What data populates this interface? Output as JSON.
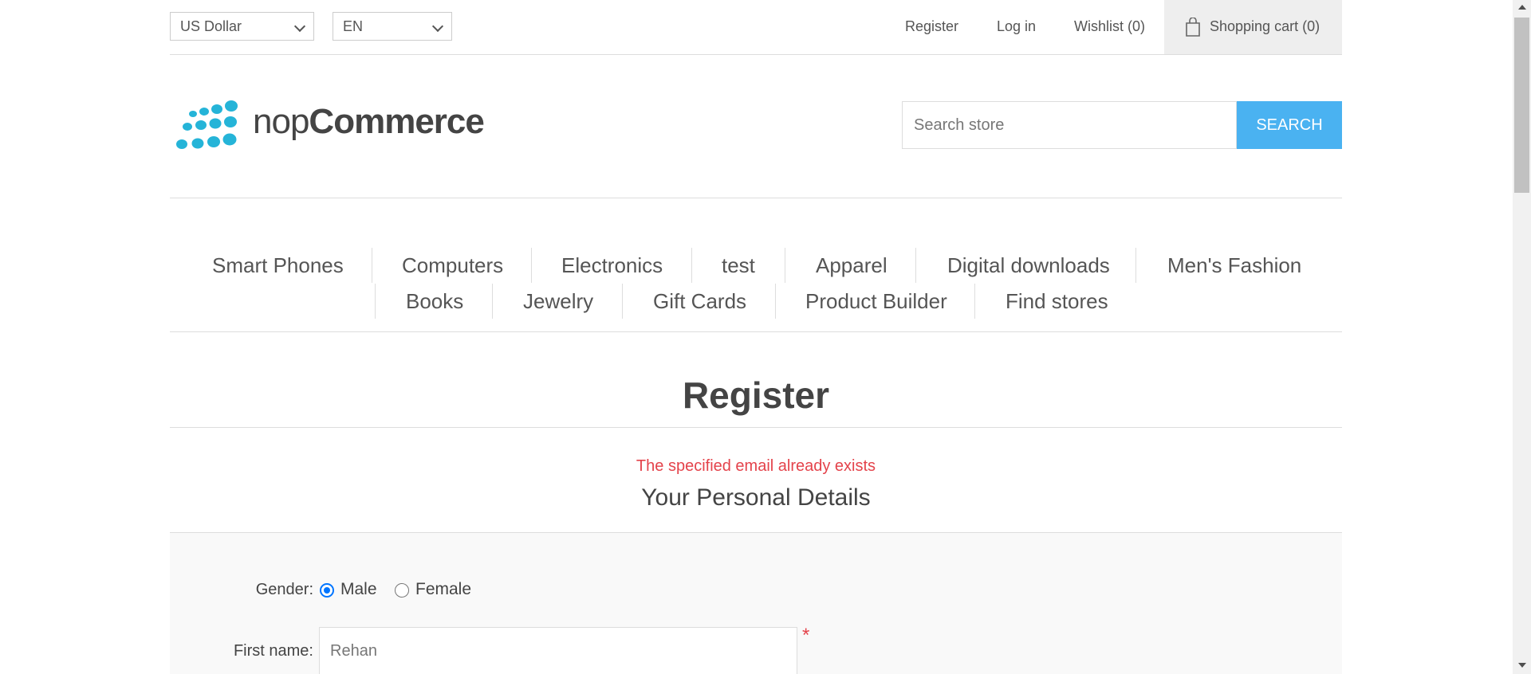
{
  "header": {
    "currency": "US Dollar",
    "language": "EN",
    "links": {
      "register": "Register",
      "login": "Log in",
      "wishlist": "Wishlist (0)",
      "cart": "Shopping cart (0)"
    }
  },
  "logo": {
    "text_light": "nop",
    "text_bold": "Commerce",
    "brand_color": "#25b4d8"
  },
  "search": {
    "placeholder": "Search store",
    "button_label": "SEARCH",
    "button_color": "#4ab2f1"
  },
  "menu": {
    "items": [
      "Smart Phones",
      "Computers",
      "Electronics",
      "test",
      "Apparel",
      "Digital downloads",
      "Men's Fashion",
      "Books",
      "Jewelry",
      "Gift Cards",
      "Product Builder",
      "Find stores"
    ]
  },
  "page": {
    "title": "Register",
    "error": "The specified email already exists",
    "section_title": "Your Personal Details"
  },
  "form": {
    "gender_label": "Gender:",
    "gender_options": [
      "Male",
      "Female"
    ],
    "gender_selected": "Male",
    "first_name_label": "First name:",
    "first_name_value": "Rehan",
    "required_mark": "*"
  },
  "colors": {
    "error": "#e4434b",
    "radio_selected": "#0075ff"
  }
}
